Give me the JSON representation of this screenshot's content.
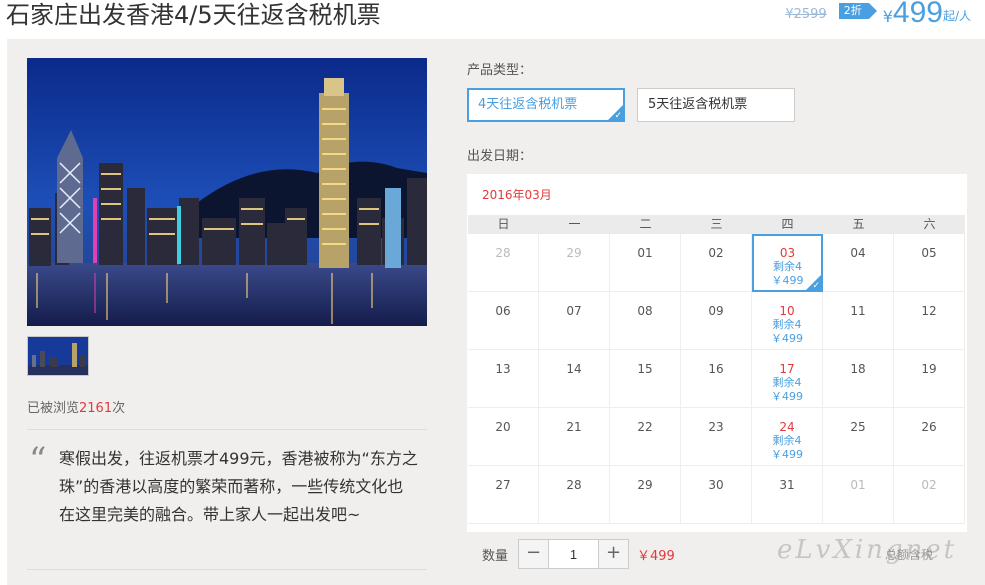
{
  "header": {
    "title": "石家庄出发香港4/5天往返含税机票",
    "original_price": "¥2599",
    "discount": "2折",
    "currency": "¥",
    "price": "499",
    "price_unit": "起/人"
  },
  "gallery": {
    "views_prefix": "已被浏览",
    "views_count": "2161",
    "views_suffix": "次"
  },
  "description": {
    "quote_mark": "“",
    "text": "寒假出发，往返机票才499元，香港被称为“东方之珠”的香港以高度的繁荣而著称，一些传统文化也在这里完美的融合。带上家人一起出发吧~"
  },
  "product": {
    "type_label": "产品类型：",
    "options": [
      {
        "label": "4天往返含税机票",
        "selected": true
      },
      {
        "label": "5天往返含税机票",
        "selected": false
      }
    ],
    "date_label": "出发日期："
  },
  "calendar": {
    "month": "2016年03月",
    "weekdays": [
      "日",
      "一",
      "二",
      "三",
      "四",
      "五",
      "六"
    ],
    "cells": [
      {
        "day": "28",
        "muted": true
      },
      {
        "day": "29",
        "muted": true
      },
      {
        "day": "01"
      },
      {
        "day": "02"
      },
      {
        "day": "03",
        "avail": true,
        "selected": true,
        "remain": "剩余4",
        "price": "￥499"
      },
      {
        "day": "04"
      },
      {
        "day": "05"
      },
      {
        "day": "06"
      },
      {
        "day": "07"
      },
      {
        "day": "08"
      },
      {
        "day": "09"
      },
      {
        "day": "10",
        "avail": true,
        "remain": "剩余4",
        "price": "￥499"
      },
      {
        "day": "11"
      },
      {
        "day": "12"
      },
      {
        "day": "13"
      },
      {
        "day": "14"
      },
      {
        "day": "15"
      },
      {
        "day": "16"
      },
      {
        "day": "17",
        "avail": true,
        "remain": "剩余4",
        "price": "￥499"
      },
      {
        "day": "18"
      },
      {
        "day": "19"
      },
      {
        "day": "20"
      },
      {
        "day": "21"
      },
      {
        "day": "22"
      },
      {
        "day": "23"
      },
      {
        "day": "24",
        "avail": true,
        "remain": "剩余4",
        "price": "￥499"
      },
      {
        "day": "25"
      },
      {
        "day": "26"
      },
      {
        "day": "27"
      },
      {
        "day": "28"
      },
      {
        "day": "29"
      },
      {
        "day": "30"
      },
      {
        "day": "31"
      },
      {
        "day": "01",
        "muted": true
      },
      {
        "day": "02",
        "muted": true
      }
    ]
  },
  "order": {
    "qty_label": "数量",
    "minus": "−",
    "plus": "+",
    "qty_value": "1",
    "price": "￥499",
    "total_note": "总额含税",
    "watermark": "eLvXingnet"
  },
  "colors": {
    "accent": "#4a9fe0",
    "price_red": "#e4393c",
    "panel_bg": "#f0efed"
  }
}
